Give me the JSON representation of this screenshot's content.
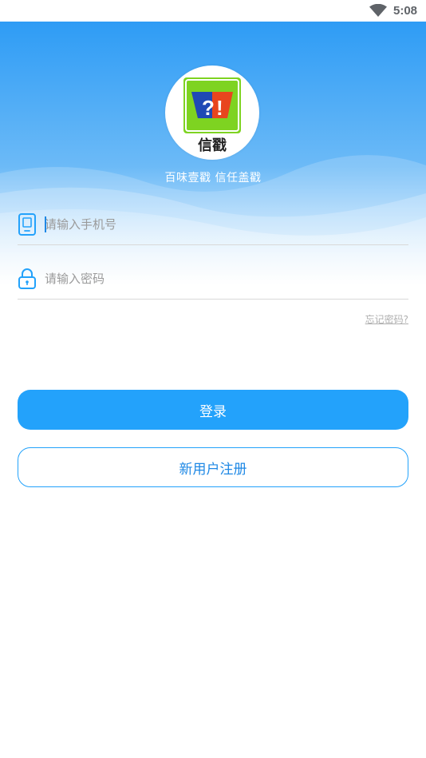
{
  "status_bar": {
    "time": "5:08",
    "wifi_icon": "wifi-icon"
  },
  "header": {
    "logo_text": "信戳",
    "logo_symbols": "?!",
    "slogan": "百味壹戳 信任盖戳",
    "gradient_top": "#2e9cf5",
    "gradient_bottom": "#ffffff"
  },
  "login_form": {
    "phone": {
      "placeholder": "请输入手机号",
      "icon": "phone-icon"
    },
    "password": {
      "placeholder": "请输入密码",
      "icon": "lock-icon"
    },
    "forgot_password": "忘记密码?",
    "login_button": "登录",
    "register_button": "新用户注册"
  },
  "colors": {
    "accent": "#23a2fb",
    "input_icon": "#23a2fb",
    "placeholder": "#9a9a9a"
  }
}
